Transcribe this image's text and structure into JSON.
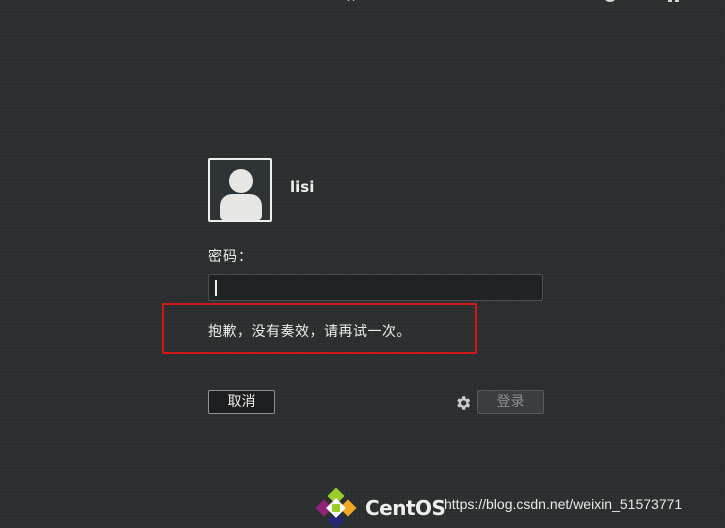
{
  "login": {
    "username": "lisi",
    "password_label": "密码：",
    "password_value": "",
    "error_message": "抱歉，没有奏效，请再试一次。",
    "cancel_label": "取消",
    "login_label": "登录"
  },
  "branding": {
    "logo_text": "CentOS",
    "watermark": "https://blog.csdn.net/weixin_51573771"
  },
  "icons": {
    "avatar": "user-avatar-icon",
    "settings": "gear-icon",
    "logo": "centos-logo-icon"
  },
  "colors": {
    "background": "#2b2f30",
    "error_highlight": "#d01818",
    "text": "#eeeeec"
  }
}
